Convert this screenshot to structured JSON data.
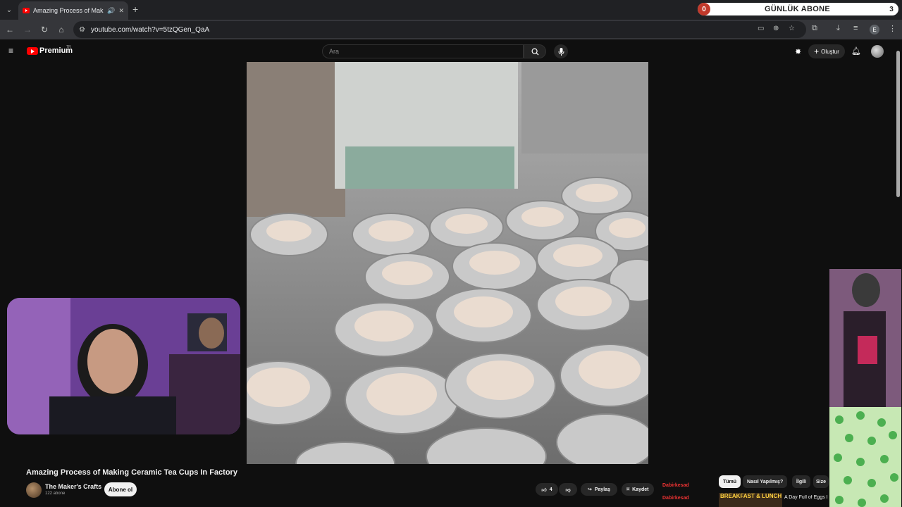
{
  "browser": {
    "tab_title": "Amazing Process of Making Ceramic Tea Cups In Factory",
    "url": "youtube.com/watch?v=5tzQGen_QaA",
    "profile_initial": "E"
  },
  "sub_goal": {
    "label": "GÜNLÜK ABONE",
    "current": "0",
    "target": "3"
  },
  "youtube": {
    "logo_text": "Premium",
    "region": "TR",
    "search_placeholder": "Ara",
    "create_label": "Oluştur"
  },
  "video": {
    "title": "Amazing Process of Making Ceramic Tea Cups In Factory",
    "channel": "The Maker's Crafts",
    "subscribers": "122 abone",
    "subscribe_label": "Abone ol",
    "likes": "4",
    "share_label": "Paylaş",
    "save_label": "Kaydet"
  },
  "filter_chips": [
    "Tümü",
    "Nasıl Yapılmış?",
    "İlgili",
    "Size"
  ],
  "overlay_chat": [
    "Dabirkesad",
    "Dabirkesad"
  ],
  "related": {
    "thumb_text": "BREAKFAST & LUNCH",
    "title": "A Day Full of Eggs I Cooking Breakfast"
  },
  "colors": {
    "youtube_red": "#ff0000",
    "background": "#0f0f0f",
    "goal_badge": "#c0392b"
  }
}
